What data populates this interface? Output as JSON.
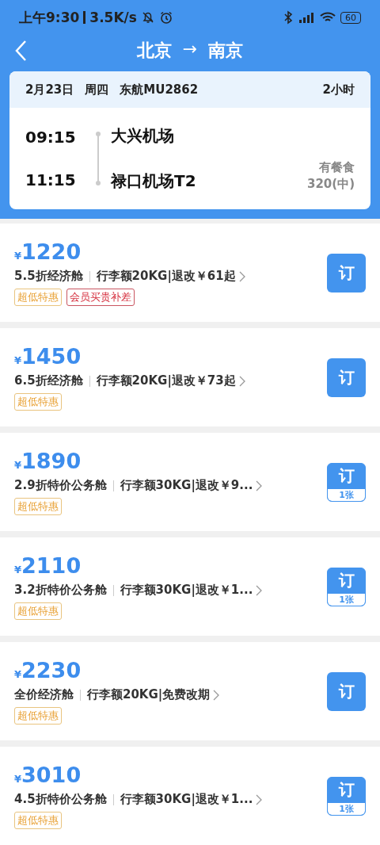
{
  "status_bar": {
    "time": "上午9:30",
    "speed": "3.5K/s",
    "battery": "60"
  },
  "nav": {
    "from": "北京",
    "arrow": "→",
    "to": "南京"
  },
  "flight": {
    "date": "2月23日",
    "weekday": "周四",
    "flight_no": "东航MU2862",
    "duration": "2小时",
    "depart_time": "09:15",
    "depart_airport": "大兴机场",
    "arrive_time": "11:15",
    "arrive_airport": "禄口机场T2",
    "meal": "有餐食",
    "aircraft": "320(中)"
  },
  "fares": [
    {
      "currency": "¥",
      "price": "1220",
      "cabin": "5.5折经济舱",
      "rules": "行李额20KG|退改￥61起",
      "book": "订",
      "tags": [
        {
          "text": "超低特惠",
          "kind": "deal"
        },
        {
          "text": "会员买贵补差",
          "kind": "member"
        }
      ]
    },
    {
      "currency": "¥",
      "price": "1450",
      "cabin": "6.5折经济舱",
      "rules": "行李额20KG|退改￥73起",
      "book": "订",
      "tags": [
        {
          "text": "超低特惠",
          "kind": "deal"
        }
      ]
    },
    {
      "currency": "¥",
      "price": "1890",
      "cabin": "2.9折特价公务舱",
      "rules": "行李额30KG|退改￥9...",
      "book": "订",
      "quota": "1张",
      "tags": [
        {
          "text": "超低特惠",
          "kind": "deal"
        }
      ]
    },
    {
      "currency": "¥",
      "price": "2110",
      "cabin": "3.2折特价公务舱",
      "rules": "行李额30KG|退改￥1...",
      "book": "订",
      "quota": "1张",
      "tags": [
        {
          "text": "超低特惠",
          "kind": "deal"
        }
      ]
    },
    {
      "currency": "¥",
      "price": "2230",
      "cabin": "全价经济舱",
      "rules": "行李额20KG|免费改期",
      "book": "订",
      "tags": [
        {
          "text": "超低特惠",
          "kind": "deal"
        }
      ]
    },
    {
      "currency": "¥",
      "price": "3010",
      "cabin": "4.5折特价公务舱",
      "rules": "行李额30KG|退改￥1...",
      "book": "订",
      "quota": "1张",
      "tags": [
        {
          "text": "超低特惠",
          "kind": "deal"
        }
      ]
    }
  ]
}
